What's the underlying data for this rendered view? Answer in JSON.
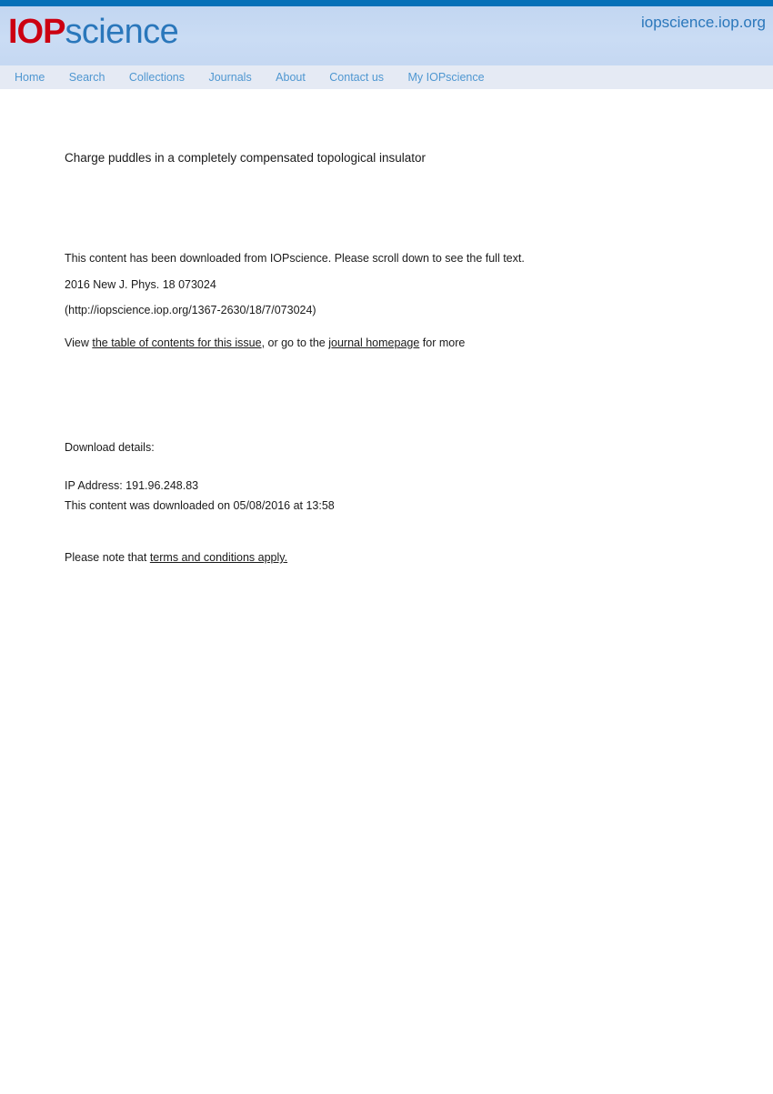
{
  "header": {
    "logo": {
      "primary": "IOP",
      "secondary": "science",
      "primary_color": "#cc0011",
      "secondary_color": "#2a77bb"
    },
    "site_url": "iopscience.iop.org",
    "topbar_color": "#0570b8",
    "band_color": "#c6d9f2",
    "nav_bg_color": "#e5eaf4",
    "nav": [
      {
        "label": "Home"
      },
      {
        "label": "Search"
      },
      {
        "label": "Collections"
      },
      {
        "label": "Journals"
      },
      {
        "label": "About"
      },
      {
        "label": "Contact us"
      },
      {
        "label": "My IOPscience"
      }
    ]
  },
  "main": {
    "article_title": "Charge puddles in a completely compensated topological insulator",
    "scroll_notice": "This content has been downloaded from IOPscience. Please scroll down to see the full text.",
    "citation": "2016 New J. Phys. 18 073024",
    "article_url": "(http://iopscience.iop.org/1367-2630/18/7/073024)",
    "view_line": {
      "prefix": "View ",
      "toc_link": "the table of contents for this issue",
      "middle": ", or go to the ",
      "journal_link": "journal homepage",
      "suffix": " for more"
    },
    "download_details": {
      "heading": "Download details:",
      "ip_address": "IP Address: 191.96.248.83",
      "downloaded_on": "This content was downloaded on 05/08/2016 at 13:58"
    },
    "terms_line": {
      "prefix": "Please note that ",
      "link": "terms and conditions apply."
    }
  }
}
